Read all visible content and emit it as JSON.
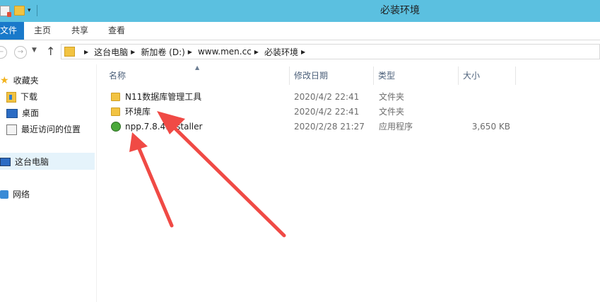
{
  "window": {
    "title": "必装环境"
  },
  "ribbon": {
    "tabs": [
      {
        "label": "文件"
      },
      {
        "label": "主页"
      },
      {
        "label": "共享"
      },
      {
        "label": "查看"
      }
    ]
  },
  "address": {
    "crumbs": [
      "这台电脑",
      "新加卷 (D:)",
      "www.men.cc",
      "必装环境"
    ]
  },
  "navpane": {
    "items": [
      {
        "label": "收藏夹",
        "icon": "star-icon"
      },
      {
        "label": "下载",
        "icon": "downloads-folder-icon"
      },
      {
        "label": "桌面",
        "icon": "desktop-icon"
      },
      {
        "label": "最近访问的位置",
        "icon": "recent-places-icon"
      },
      {
        "label": "这台电脑",
        "icon": "computer-icon"
      },
      {
        "label": "网络",
        "icon": "network-icon"
      }
    ]
  },
  "columns": {
    "name": "名称",
    "date": "修改日期",
    "type": "类型",
    "size": "大小"
  },
  "files": [
    {
      "name": "N11数据库管理工具",
      "date": "2020/4/2 22:41",
      "type": "文件夹",
      "size": "",
      "icon": "folder-icon"
    },
    {
      "name": "环境库",
      "date": "2020/4/2 22:41",
      "type": "文件夹",
      "size": "",
      "icon": "folder-icon"
    },
    {
      "name": "npp.7.8.4.Installer",
      "date": "2020/2/28 21:27",
      "type": "应用程序",
      "size": "3,650 KB",
      "icon": "notepadpp-app-icon"
    }
  ],
  "colors": {
    "titlebar": "#5bc0e0",
    "file_tab": "#1979ca",
    "selection": "#e5f3fb",
    "annotation_arrow": "#f04a45"
  }
}
